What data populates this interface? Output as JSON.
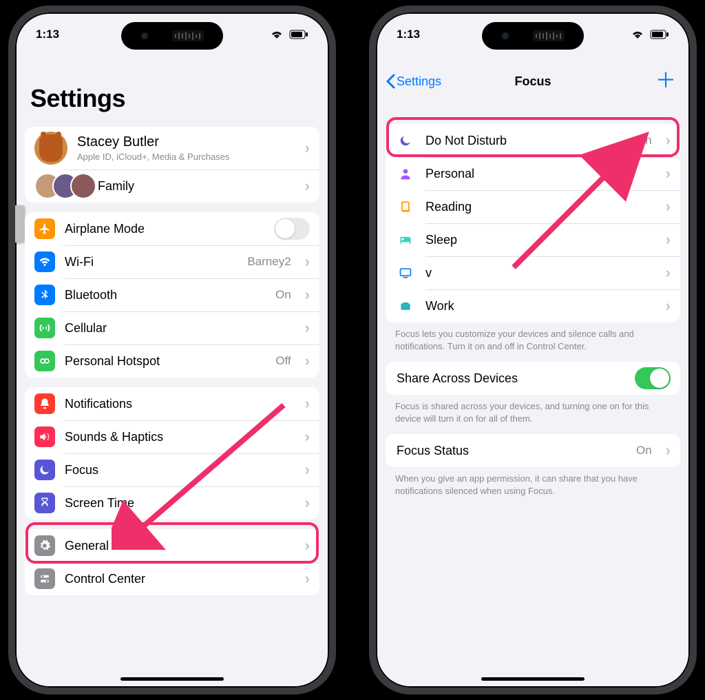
{
  "status_time": "1:13",
  "left": {
    "title": "Settings",
    "account": {
      "name": "Stacey Butler",
      "sub": "Apple ID, iCloud+, Media & Purchases"
    },
    "family_label": "Family",
    "airplane": "Airplane Mode",
    "wifi": {
      "label": "Wi-Fi",
      "value": "Barney2"
    },
    "bluetooth": {
      "label": "Bluetooth",
      "value": "On"
    },
    "cellular": "Cellular",
    "hotspot": {
      "label": "Personal Hotspot",
      "value": "Off"
    },
    "notifications": "Notifications",
    "sounds": "Sounds & Haptics",
    "focus": "Focus",
    "screentime": "Screen Time",
    "general": "General",
    "controlcenter": "Control Center"
  },
  "right": {
    "back": "Settings",
    "title": "Focus",
    "modes": [
      {
        "label": "Do Not Disturb",
        "value": "On",
        "color": "#5856d6",
        "icon": "moon"
      },
      {
        "label": "Personal",
        "value": "",
        "color": "#a259ff",
        "icon": "person"
      },
      {
        "label": "Reading",
        "value": "",
        "color": "#ff9500",
        "icon": "book"
      },
      {
        "label": "Sleep",
        "value": "",
        "color": "#30d6c4",
        "icon": "bed"
      },
      {
        "label": "v",
        "value": "",
        "color": "#007aff",
        "icon": "tv"
      },
      {
        "label": "Work",
        "value": "",
        "color": "#30b0c7",
        "icon": "briefcase"
      }
    ],
    "footer1": "Focus lets you customize your devices and silence calls and notifications. Turn it on and off in Control Center.",
    "share_label": "Share Across Devices",
    "footer2": "Focus is shared across your devices, and turning one on for this device will turn it on for all of them.",
    "status_label": "Focus Status",
    "status_value": "On",
    "footer3": "When you give an app permission, it can share that you have notifications silenced when using Focus."
  }
}
